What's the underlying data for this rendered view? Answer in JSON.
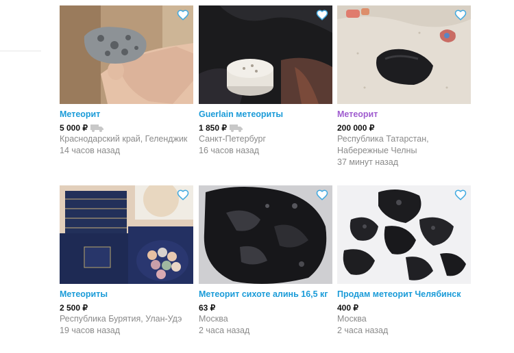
{
  "listings": [
    {
      "title": "Метеорит",
      "price": "5 000 ₽",
      "location": "Краснодарский край, Геленджик",
      "time": "14 часов назад",
      "delivery": true,
      "visited": false,
      "heart_icon": "favorite-heart-icon"
    },
    {
      "title": "Guerlain метеориты",
      "price": "1 850 ₽",
      "location": "Санкт-Петербург",
      "time": "16 часов назад",
      "delivery": true,
      "visited": false,
      "heart_icon": "favorite-heart-icon"
    },
    {
      "title": "Метеорит",
      "price": "200 000 ₽",
      "location": "Республика Татарстан, Набережные Челны",
      "time": "37 минут назад",
      "delivery": false,
      "visited": true,
      "heart_icon": "favorite-heart-icon"
    },
    {
      "title": "Метеориты",
      "price": "2 500 ₽",
      "location": "Республика Бурятия, Улан-Удэ",
      "time": "19 часов назад",
      "delivery": false,
      "visited": false,
      "heart_icon": "favorite-heart-icon"
    },
    {
      "title": "Метеорит сихоте алинь 16,5 кг",
      "price": "63 ₽",
      "location": "Москва",
      "time": "2 часа назад",
      "delivery": false,
      "visited": false,
      "heart_icon": "favorite-heart-icon"
    },
    {
      "title": "Продам метеорит Челябинск",
      "price": "400 ₽",
      "location": "Москва",
      "time": "2 часа назад",
      "delivery": false,
      "visited": false,
      "heart_icon": "favorite-heart-icon"
    }
  ],
  "colors": {
    "link": "#1a9bd8",
    "visited_link": "#9f5ccf",
    "meta": "#8a8a8a",
    "heart": "#3fa9e0"
  }
}
